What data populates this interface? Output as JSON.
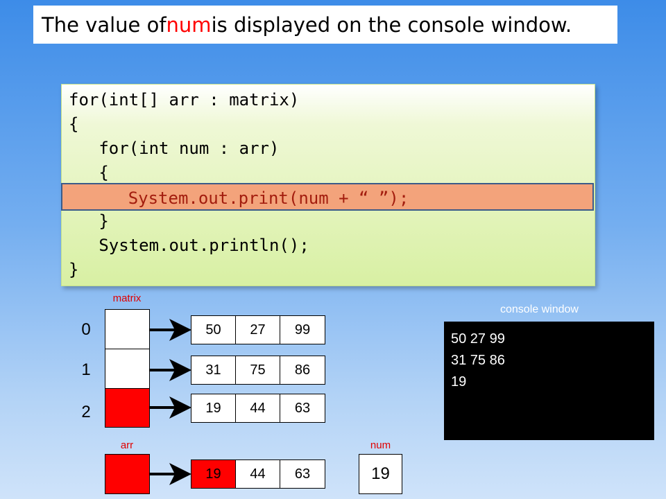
{
  "title": {
    "prefix": "The value of ",
    "highlight": "num",
    "suffix": " is displayed on the console window."
  },
  "code": {
    "lines": [
      "for(int[] arr : matrix)",
      "{",
      "   for(int num : arr)",
      "   {",
      "      System.out.print(num + “ ”);",
      "   }",
      "   System.out.println();",
      "}"
    ],
    "highlighted_line_index": 4
  },
  "labels": {
    "matrix": "matrix",
    "arr": "arr",
    "num": "num",
    "console": "console window"
  },
  "matrix": {
    "indices": [
      "0",
      "1",
      "2"
    ],
    "highlighted_row": 2,
    "rows": [
      [
        "50",
        "27",
        "99"
      ],
      [
        "31",
        "75",
        "86"
      ],
      [
        "19",
        "44",
        "63"
      ]
    ]
  },
  "arr": {
    "values": [
      "19",
      "44",
      "63"
    ],
    "highlighted_index": 0
  },
  "num": {
    "value": "19"
  },
  "console": {
    "lines": [
      "50 27 99",
      "31 75 86",
      "19"
    ]
  },
  "colors": {
    "highlight_red": "#ff0000",
    "code_highlight_bg": "#f3a37b",
    "code_highlight_text": "#a31d0e"
  }
}
